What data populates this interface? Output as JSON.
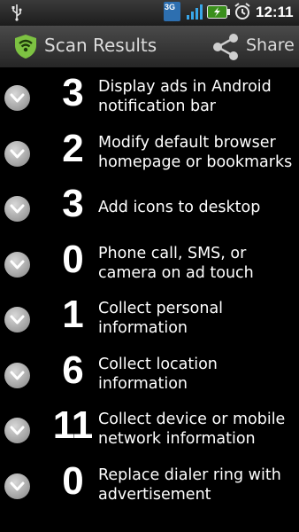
{
  "status_bar": {
    "network_label": "3G",
    "time": "12:11",
    "icons": [
      "usb-icon",
      "3g-icon",
      "signal-icon",
      "battery-charging-icon",
      "alarm-icon"
    ]
  },
  "title_bar": {
    "title": "Scan Results",
    "share_label": "Share",
    "accent_color": "#7dc242"
  },
  "results": [
    {
      "count": "3",
      "text": "Display ads in Android notification bar"
    },
    {
      "count": "2",
      "text": "Modify default browser homepage or bookmarks"
    },
    {
      "count": "3",
      "text": "Add icons to desktop"
    },
    {
      "count": "0",
      "text": "Phone call, SMS, or camera on ad touch"
    },
    {
      "count": "1",
      "text": "Collect personal information"
    },
    {
      "count": "6",
      "text": "Collect location information"
    },
    {
      "count": "11",
      "text": "Collect device or mobile network information"
    },
    {
      "count": "0",
      "text": "Replace dialer ring with advertisement"
    }
  ]
}
